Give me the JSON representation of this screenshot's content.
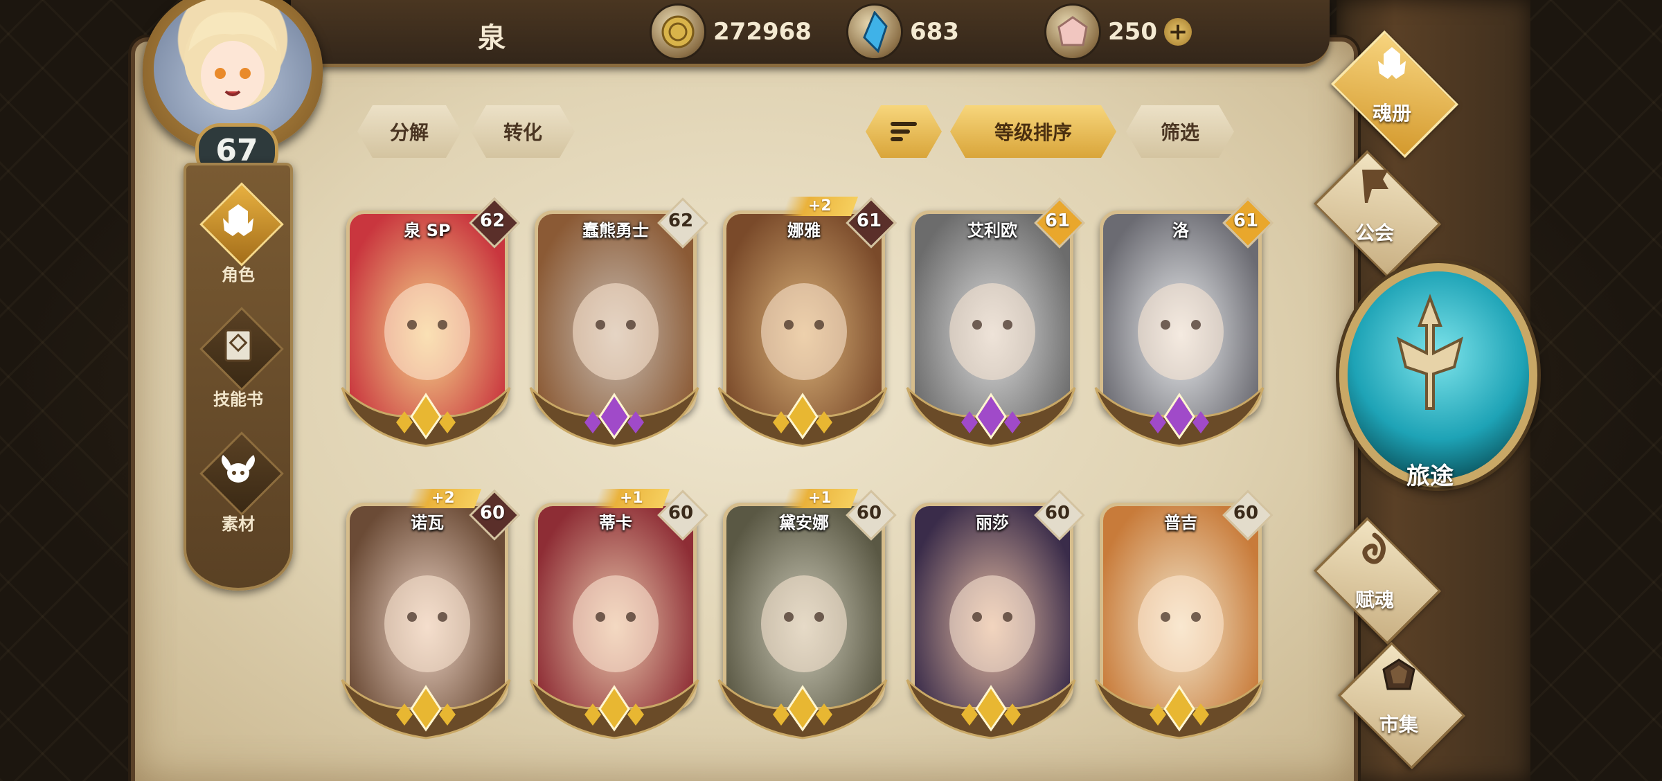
{
  "player": {
    "name": "泉",
    "level": "67"
  },
  "currencies": [
    {
      "icon": "gold-coin-icon",
      "value": "272968"
    },
    {
      "icon": "blue-crystal-icon",
      "value": "683"
    },
    {
      "icon": "pink-gem-icon",
      "value": "250"
    }
  ],
  "left_nav": [
    {
      "label": "角色",
      "icon": "character-helmet-icon",
      "active": true
    },
    {
      "label": "技能书",
      "icon": "skill-book-icon",
      "active": false
    },
    {
      "label": "素材",
      "icon": "material-icon",
      "active": false
    }
  ],
  "toolbar": {
    "decompose": "分解",
    "convert": "转化",
    "sort_by_level": "等级排序",
    "filter": "筛选"
  },
  "heroes": [
    {
      "name": "泉 SP",
      "level": "62",
      "bonus": "",
      "tier": "gold",
      "badge_color": "#5a2f2a",
      "bg": [
        "#c9363e",
        "#f4d48a"
      ]
    },
    {
      "name": "蠢熊勇士",
      "level": "62",
      "bonus": "",
      "tier": "purple",
      "badge_color": "#e3dccb",
      "bg": [
        "#8b5a35",
        "#c6b9ad"
      ]
    },
    {
      "name": "娜雅",
      "level": "61",
      "bonus": "+2",
      "tier": "gold",
      "badge_color": "#5a2f2a",
      "bg": [
        "#7a4a2a",
        "#d8b078"
      ]
    },
    {
      "name": "艾利欧",
      "level": "61",
      "bonus": "",
      "tier": "purple",
      "badge_color": "#e9a72c",
      "bg": [
        "#6c6c6c",
        "#dadada"
      ]
    },
    {
      "name": "洛",
      "level": "61",
      "bonus": "",
      "tier": "purple",
      "badge_color": "#e9a72c",
      "bg": [
        "#6b6b72",
        "#e8eaec"
      ]
    },
    {
      "name": "诺瓦",
      "level": "60",
      "bonus": "+2",
      "tier": "gold",
      "badge_color": "#5a2f2a",
      "bg": [
        "#6b4b36",
        "#e8cfc0"
      ]
    },
    {
      "name": "蒂卡",
      "level": "60",
      "bonus": "+1",
      "tier": "gold",
      "badge_color": "#e3dccb",
      "bg": [
        "#8e2d35",
        "#e6c3a8"
      ]
    },
    {
      "name": "黛安娜",
      "level": "60",
      "bonus": "+1",
      "tier": "gold",
      "badge_color": "#e3dccb",
      "bg": [
        "#5a5844",
        "#c8c6b4"
      ]
    },
    {
      "name": "丽莎",
      "level": "60",
      "bonus": "",
      "tier": "gold",
      "badge_color": "#e3dccb",
      "bg": [
        "#3a2c4a",
        "#e2b9a0"
      ]
    },
    {
      "name": "普吉",
      "level": "60",
      "bonus": "",
      "tier": "gold",
      "badge_color": "#e3dccb",
      "bg": [
        "#c87b3a",
        "#f2e4c8"
      ]
    }
  ],
  "right_nav": [
    {
      "label": "魂册",
      "icon": "soul-book-icon",
      "active": true
    },
    {
      "label": "公会",
      "icon": "guild-banner-icon",
      "active": false
    },
    {
      "label": "赋魂",
      "icon": "soul-empower-icon",
      "active": false
    },
    {
      "label": "市集",
      "icon": "market-gem-icon",
      "active": false
    }
  ],
  "journey": {
    "label": "旅途",
    "icon": "journey-emblem-icon"
  }
}
